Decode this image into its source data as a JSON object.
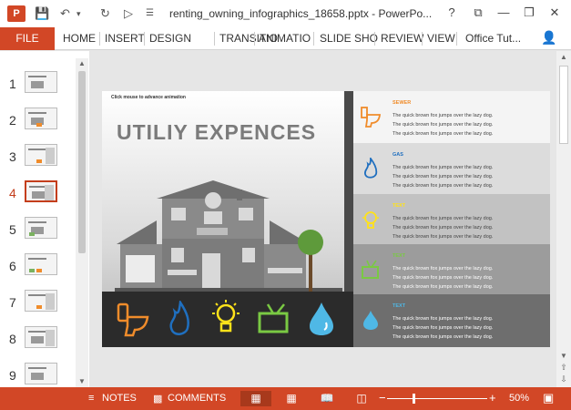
{
  "window": {
    "title": "renting_owning_infographics_18658.pptx - PowerPo...",
    "app_icon_letter": "P"
  },
  "ribbon": {
    "file_label": "FILE",
    "tabs": [
      "HOME",
      "INSERT",
      "DESIGN",
      "TRANSITIO",
      "ANIMATIO",
      "SLIDE SHO",
      "REVIEW",
      "VIEW"
    ],
    "account": "Office Tut..."
  },
  "thumbnails": {
    "numbers": [
      "1",
      "2",
      "3",
      "4",
      "5",
      "6",
      "7",
      "8",
      "9"
    ],
    "active_index": 4
  },
  "slide": {
    "hint": "Click mouse to advance animation",
    "heading": "UTILIY EXPENCES",
    "rows": [
      {
        "label": "SEWER",
        "color": "#f08c2b",
        "bg": "#f4f4f4",
        "lines": [
          "The quick brown fox jumps over the lazy dog.",
          "The quick brown fox jumps over the lazy dog.",
          "The quick brown fox jumps over the lazy dog."
        ]
      },
      {
        "label": "GAS",
        "color": "#1f6fbf",
        "bg": "#dcdcdc",
        "lines": [
          "The quick brown fox jumps over the lazy dog.",
          "The quick brown fox jumps over the lazy dog.",
          "The quick brown fox jumps over the lazy dog."
        ]
      },
      {
        "label": "TEXT",
        "color": "#e8e020",
        "bg": "#c2c2c2",
        "lines": [
          "The quick brown fox jumps over the lazy dog.",
          "The quick brown fox jumps over the lazy dog.",
          "The quick brown fox jumps over the lazy dog."
        ]
      },
      {
        "label": "TEXT",
        "color": "#7ac943",
        "bg": "#9c9c9c",
        "lines": [
          "The quick brown fox jumps over the lazy dog.",
          "The quick brown fox jumps over the lazy dog.",
          "The quick brown fox jumps over the lazy dog."
        ]
      },
      {
        "label": "TEXT",
        "color": "#4fb8e6",
        "bg": "#6e6e6e",
        "lines": [
          "The quick brown fox jumps over the lazy dog.",
          "The quick brown fox jumps over the lazy dog.",
          "The quick brown fox jumps over the lazy dog."
        ]
      }
    ]
  },
  "statusbar": {
    "notes": "NOTES",
    "comments": "COMMENTS",
    "zoom": "50%",
    "minus": "−",
    "plus": "+"
  },
  "colors": {
    "accent": "#d24726",
    "accent_dark": "#a8391c"
  }
}
